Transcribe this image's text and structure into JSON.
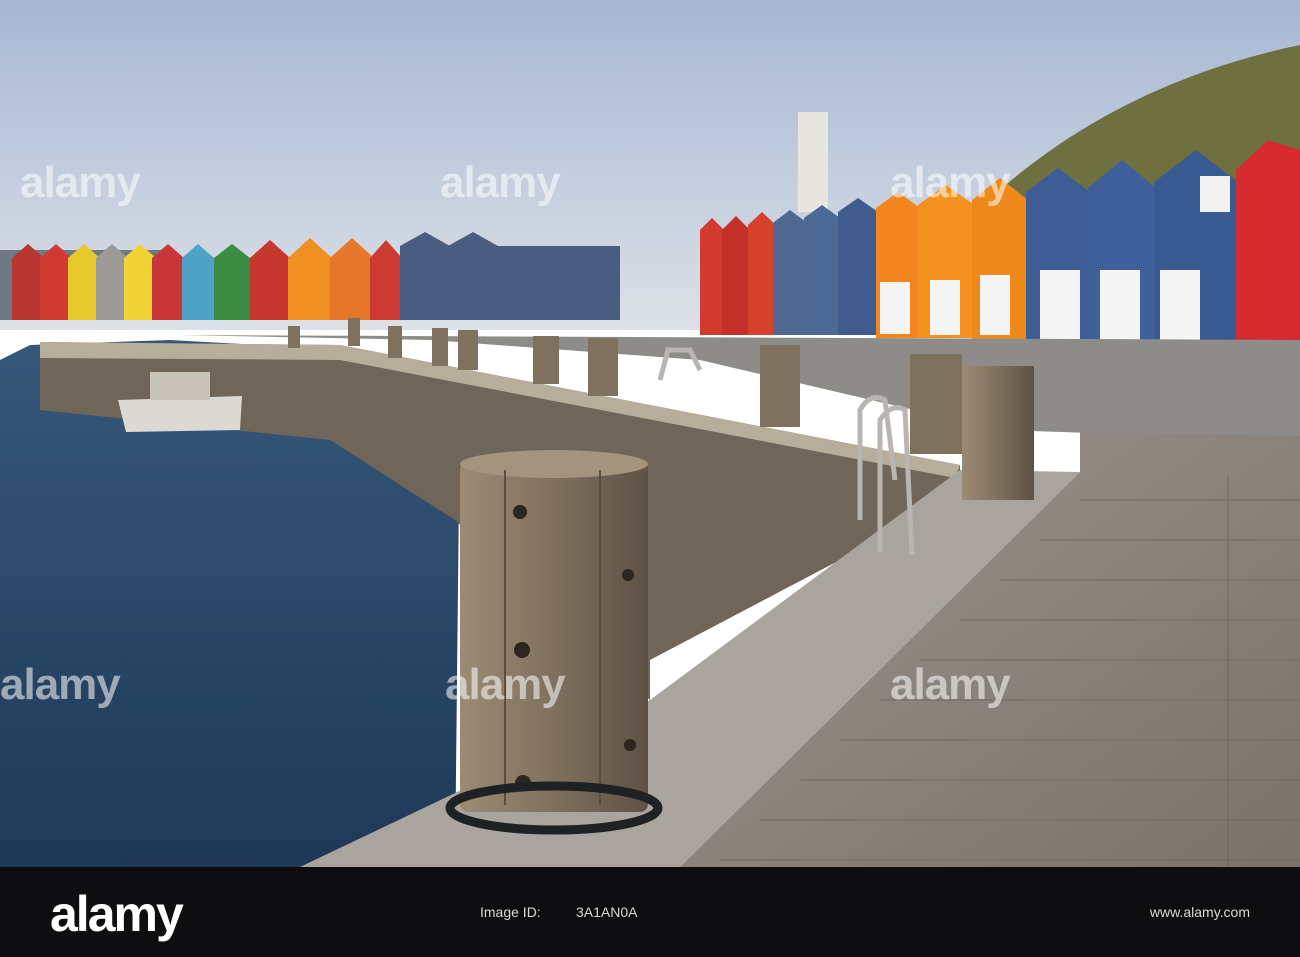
{
  "photo": {
    "subject": "harbour promenade with colourful houses",
    "colors": {
      "sky_top": "#a9b9d4",
      "sky_bottom": "#dbe1e8",
      "water": "#2d4a68",
      "deck": "#8f8a84",
      "bollard": "#8a7a66"
    }
  },
  "watermarks": {
    "text": "alamy"
  },
  "footer": {
    "brand": "alamy",
    "image_id_label": "Image ID:",
    "image_id": "3A1AN0A",
    "site": "www.alamy.com"
  }
}
